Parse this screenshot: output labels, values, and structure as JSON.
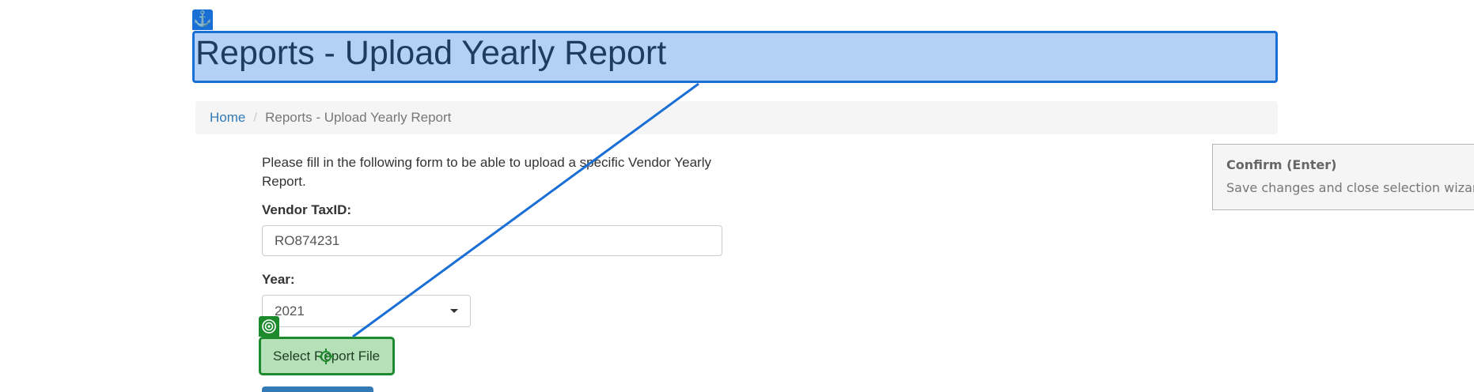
{
  "page": {
    "title": "Reports - Upload Yearly Report"
  },
  "breadcrumb": {
    "home": "Home",
    "separator": "/",
    "current": "Reports - Upload Yearly Report"
  },
  "form": {
    "intro": "Please fill in the following form to be able to upload a specific Vendor Yearly Report.",
    "taxid_label": "Vendor TaxID:",
    "taxid_value": "RO874231",
    "year_label": "Year:",
    "year_value": "2021",
    "file_button_label": "Select Report File"
  },
  "overlay": {
    "anchor_icon": "⚓",
    "anchor_color": "#1a6fd6",
    "target_color": "#1d8a2e",
    "confirm_title": "Confirm (Enter)",
    "confirm_body": "Save changes and close selection wizard"
  },
  "colors": {
    "link": "#337ab7",
    "anchor_fill": "#b3d1f5",
    "target_fill": "#b5e0b8",
    "primary_button": "#337ab7"
  }
}
